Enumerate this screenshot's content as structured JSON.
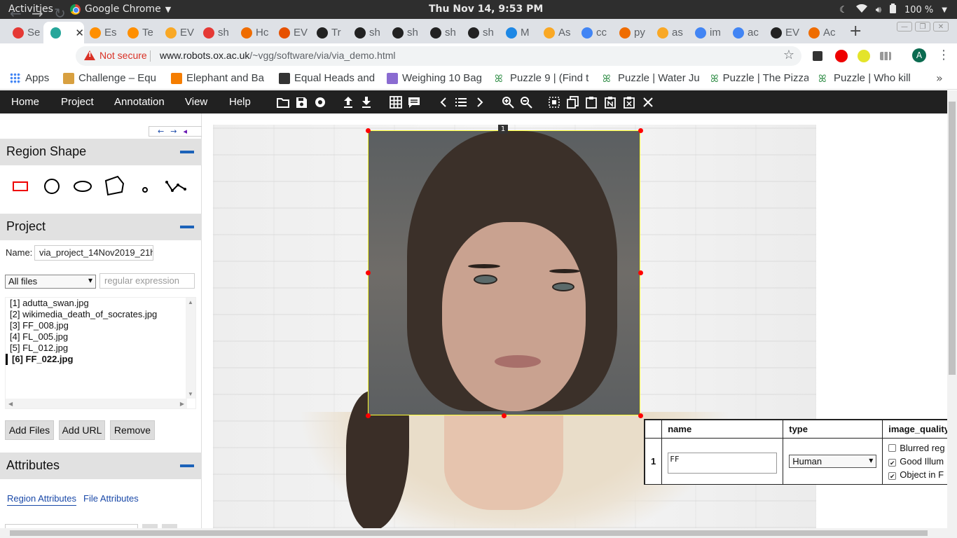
{
  "os_topbar": {
    "activities": "Activities",
    "app": "Google Chrome",
    "clock": "Thu Nov 14,  9:53 PM",
    "battery": "100 %"
  },
  "tabs": [
    {
      "label": "Se",
      "color": "#e53935"
    },
    {
      "label": "",
      "color": "#26a69a",
      "active": true
    },
    {
      "label": "Es",
      "color": "#ff8f00"
    },
    {
      "label": "Te",
      "color": "#ff8f00"
    },
    {
      "label": "EV",
      "color": "#f9a825"
    },
    {
      "label": "sh",
      "color": "#e53935"
    },
    {
      "label": "Hc",
      "color": "#ef6c00"
    },
    {
      "label": "EV",
      "color": "#e65100"
    },
    {
      "label": "Tr",
      "color": "#222222"
    },
    {
      "label": "sh",
      "color": "#222222"
    },
    {
      "label": "sh",
      "color": "#222222"
    },
    {
      "label": "sh",
      "color": "#222222"
    },
    {
      "label": "sh",
      "color": "#222222"
    },
    {
      "label": "M",
      "color": "#1e88e5"
    },
    {
      "label": "As",
      "color": "#f9a825"
    },
    {
      "label": "cc",
      "color": "#4285f4"
    },
    {
      "label": "py",
      "color": "#ef6c00"
    },
    {
      "label": "as",
      "color": "#f9a825"
    },
    {
      "label": "im",
      "color": "#4285f4"
    },
    {
      "label": "ac",
      "color": "#4285f4"
    },
    {
      "label": "EV",
      "color": "#222222"
    },
    {
      "label": "Ac",
      "color": "#ef6c00"
    }
  ],
  "address_bar": {
    "security": "Not secure",
    "url_host": "www.robots.ox.ac.uk",
    "url_path": "/~vgg/software/via/via_demo.html"
  },
  "bookmarks": [
    {
      "label": "Apps",
      "icon": "apps-grid-icon"
    },
    {
      "label": "Challenge – Equ",
      "icon": "page-icon"
    },
    {
      "label": "Elephant and Ba",
      "icon": "blogger-icon"
    },
    {
      "label": "Equal Heads and",
      "icon": "puzzle-icon"
    },
    {
      "label": "Weighing 10 Bag",
      "icon": "cube-icon"
    },
    {
      "label": "Puzzle 9 | (Find t",
      "icon": "gfg-icon"
    },
    {
      "label": "Puzzle | Water Ju",
      "icon": "gfg-icon"
    },
    {
      "label": "Puzzle | The Pizza",
      "icon": "gfg-icon"
    },
    {
      "label": "Puzzle | Who kill",
      "icon": "gfg-icon"
    }
  ],
  "via_menu": [
    "Home",
    "Project",
    "Annotation",
    "View",
    "Help"
  ],
  "toolbar_icons": [
    "open-folder-icon",
    "save-icon",
    "settings-icon",
    "upload-icon",
    "download-icon",
    "grid-icon",
    "comment-icon",
    "prev-icon",
    "list-icon",
    "next-icon",
    "zoom-in-icon",
    "zoom-out-icon",
    "select-all-icon",
    "copy-icon",
    "paste-icon",
    "paste-n-icon",
    "delete-region-icon",
    "close-icon"
  ],
  "left_panel": {
    "nav_arrows": [
      "←",
      "→",
      "◂"
    ],
    "region_shape_title": "Region Shape",
    "shapes": [
      "rectangle",
      "circle",
      "ellipse",
      "polygon",
      "point",
      "polyline"
    ],
    "project_title": "Project",
    "name_label": "Name:",
    "project_name": "via_project_14Nov2019_21h",
    "filter_select": "All files",
    "regex_placeholder": "regular expression",
    "files": [
      "[1] adutta_swan.jpg",
      "[2] wikimedia_death_of_socrates.jpg",
      "[3] FF_008.jpg",
      "[4] FL_005.jpg",
      "[5] FL_012.jpg",
      "[6] FF_022.jpg"
    ],
    "selected_file_index": 5,
    "buttons": {
      "add_files": "Add Files",
      "add_url": "Add URL",
      "remove": "Remove"
    },
    "attributes_title": "Attributes",
    "attr_tabs": {
      "region": "Region Attributes",
      "file": "File Attributes"
    }
  },
  "canvas": {
    "region_label": "1"
  },
  "annotation_editor": {
    "headers": {
      "name": "name",
      "type": "type",
      "image_quality": "image_quality"
    },
    "row_id": "1",
    "name_value": "FF",
    "type_value": "Human",
    "quality_options": [
      {
        "label": "Blurred reg",
        "checked": false
      },
      {
        "label": "Good Illum",
        "checked": true
      },
      {
        "label": "Object in F",
        "checked": true
      }
    ]
  },
  "colors": {
    "via_menubar": "#212121",
    "panel_header": "#e1e1e1",
    "accent": "#1c62b9",
    "region_border": "#ffff33",
    "handle": "#ff0000"
  }
}
